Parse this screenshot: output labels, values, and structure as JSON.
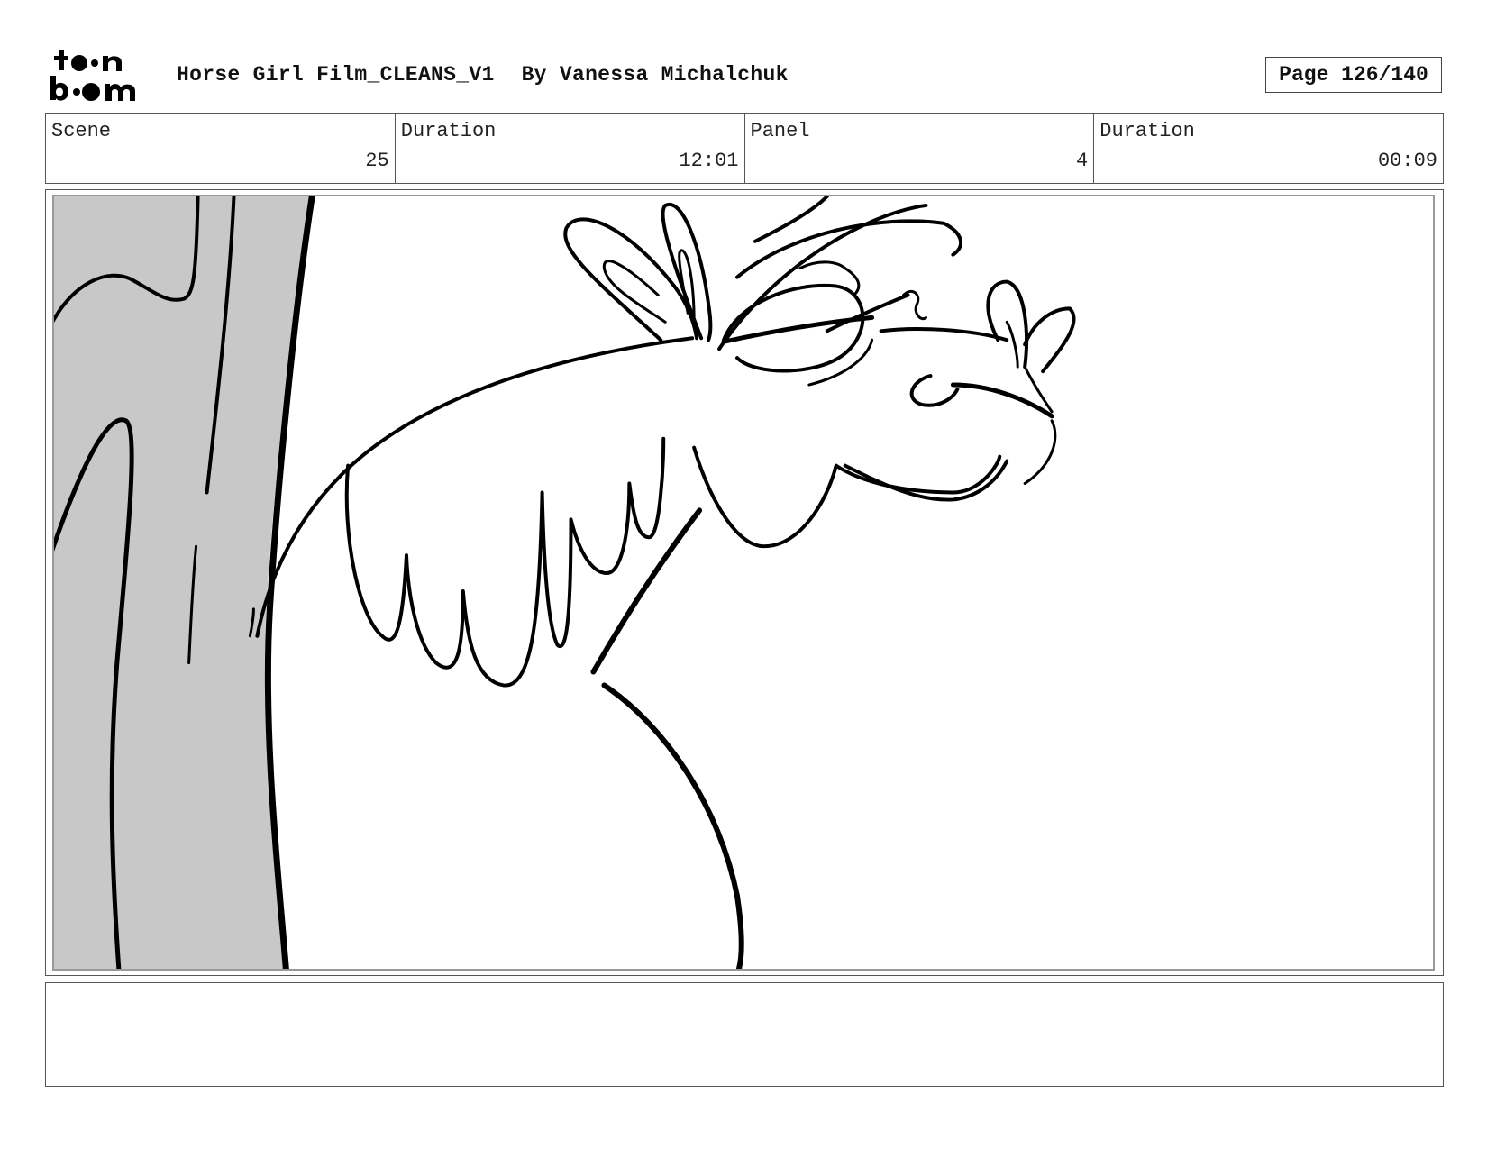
{
  "header": {
    "title": "Horse Girl Film_CLEANS_V1",
    "author": "By Vanessa Michalchuk",
    "page_label": "Page 126/140",
    "logo": "toon boom"
  },
  "info": {
    "scene_label": "Scene",
    "scene_value": "25",
    "duration_label": "Duration",
    "duration_value": "12:01",
    "panel_label": "Panel",
    "panel_value": "4",
    "panel_duration_label": "Duration",
    "panel_duration_value": "00:09"
  },
  "notes": {
    "text": ""
  },
  "colors": {
    "tree_fill": "#c8c8c8",
    "line": "#000000",
    "border": "#555555"
  }
}
